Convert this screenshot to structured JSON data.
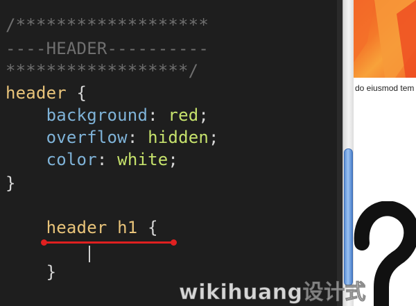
{
  "editor": {
    "lines": {
      "l1": "/*******************",
      "l2": "----HEADER----------",
      "l3": "******************/",
      "l4_selector": "header",
      "l4_brace": " {",
      "l5_prop": "background",
      "l5_colon": ": ",
      "l5_value": "red",
      "l5_semi": ";",
      "l6_prop": "overflow",
      "l6_colon": ": ",
      "l6_value": "hidden",
      "l6_semi": ";",
      "l7_prop": "color",
      "l7_colon": ": ",
      "l7_value": "white",
      "l7_semi": ";",
      "l8": "}",
      "l9_selector": "header h1",
      "l9_brace": " {",
      "l10": "}"
    },
    "indent": "    ",
    "annotation_color": "#e02020"
  },
  "preview": {
    "body_text": "do eiusmod tem",
    "image_colors": [
      "#f05a24",
      "#f8a23a"
    ]
  },
  "watermark": {
    "text": "wikihuang设计式"
  },
  "colors": {
    "background": "#1e1e1e",
    "comment": "#6f6f6f",
    "selector": "#e9c47a",
    "property": "#7fb3d8",
    "value": "#c6e26c",
    "scroll_thumb": "#5c8fd6"
  }
}
